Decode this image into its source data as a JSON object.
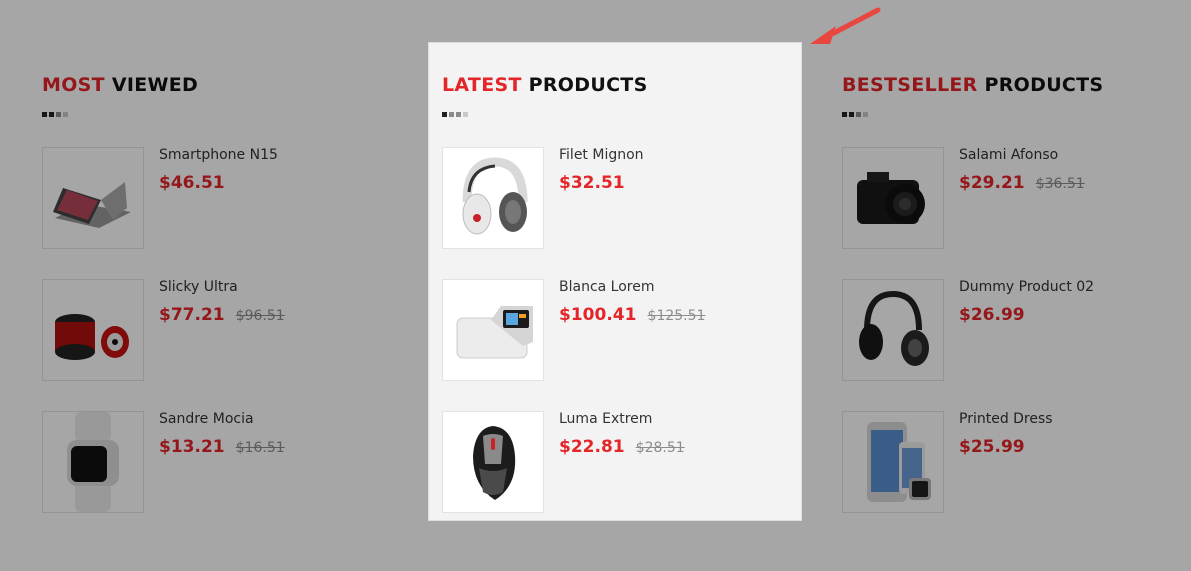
{
  "sections": {
    "most_viewed": {
      "title_accent": "MOST",
      "title_rest": "VIEWED",
      "products": [
        {
          "name": "Smartphone N15",
          "price": "$46.51",
          "old_price": ""
        },
        {
          "name": "Slicky Ultra",
          "price": "$77.21",
          "old_price": "$96.51"
        },
        {
          "name": "Sandre Mocia",
          "price": "$13.21",
          "old_price": "$16.51"
        }
      ]
    },
    "latest": {
      "title_accent": "LATEST",
      "title_rest": "PRODUCTS",
      "products": [
        {
          "name": "Filet Mignon",
          "price": "$32.51",
          "old_price": ""
        },
        {
          "name": "Blanca Lorem",
          "price": "$100.41",
          "old_price": "$125.51"
        },
        {
          "name": "Luma Extrem",
          "price": "$22.81",
          "old_price": "$28.51"
        }
      ]
    },
    "bestseller": {
      "title_accent": "BESTSELLER",
      "title_rest": "PRODUCTS",
      "products": [
        {
          "name": "Salami Afonso",
          "price": "$29.21",
          "old_price": "$36.51"
        },
        {
          "name": "Dummy Product 02",
          "price": "$26.99",
          "old_price": ""
        },
        {
          "name": "Printed Dress",
          "price": "$25.99",
          "old_price": ""
        }
      ]
    }
  },
  "colors": {
    "accent": "#e4262a",
    "overlay": "rgba(0,0,0,0.35)",
    "highlight_bg": "#f3f3f3",
    "arrow": "#e8473f"
  },
  "icons": {
    "highlight_pointer": "arrow-icon"
  }
}
